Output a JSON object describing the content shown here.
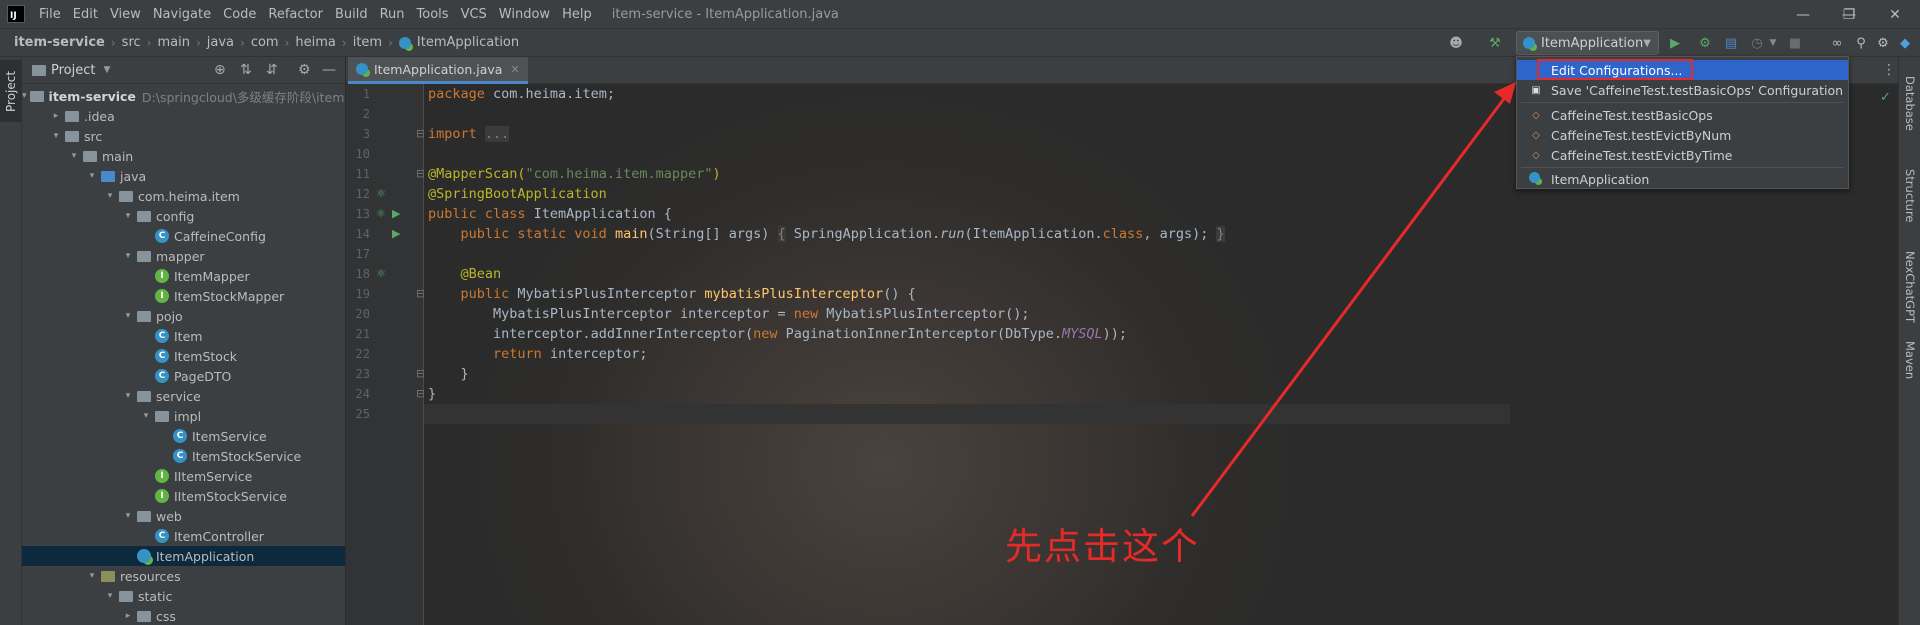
{
  "titlebar": {
    "logo": "IJ",
    "menu": [
      "File",
      "Edit",
      "View",
      "Navigate",
      "Code",
      "Refactor",
      "Build",
      "Run",
      "Tools",
      "VCS",
      "Window",
      "Help"
    ],
    "window_title": "item-service - ItemApplication.java"
  },
  "breadcrumb": [
    "item-service",
    "src",
    "main",
    "java",
    "com",
    "heima",
    "item",
    "ItemApplication"
  ],
  "run_config": {
    "selected": "ItemApplication"
  },
  "project_panel": {
    "title": "Project",
    "tree": [
      {
        "label": "item-service",
        "hint": "D:\\springcloud\\多级缓存阶段\\item-s",
        "depth": 0,
        "icon": "folder",
        "expanded": true,
        "bold": true
      },
      {
        "label": ".idea",
        "depth": 1,
        "icon": "folder",
        "expanded": false
      },
      {
        "label": "src",
        "depth": 1,
        "icon": "folder",
        "expanded": true
      },
      {
        "label": "main",
        "depth": 2,
        "icon": "folder",
        "expanded": true
      },
      {
        "label": "java",
        "depth": 3,
        "icon": "folder-blue",
        "expanded": true
      },
      {
        "label": "com.heima.item",
        "depth": 4,
        "icon": "folder",
        "expanded": true
      },
      {
        "label": "config",
        "depth": 5,
        "icon": "folder",
        "expanded": true
      },
      {
        "label": "CaffeineConfig",
        "depth": 6,
        "icon": "class"
      },
      {
        "label": "mapper",
        "depth": 5,
        "icon": "folder",
        "expanded": true
      },
      {
        "label": "ItemMapper",
        "depth": 6,
        "icon": "iface"
      },
      {
        "label": "ItemStockMapper",
        "depth": 6,
        "icon": "iface"
      },
      {
        "label": "pojo",
        "depth": 5,
        "icon": "folder",
        "expanded": true
      },
      {
        "label": "Item",
        "depth": 6,
        "icon": "class"
      },
      {
        "label": "ItemStock",
        "depth": 6,
        "icon": "class"
      },
      {
        "label": "PageDTO",
        "depth": 6,
        "icon": "class"
      },
      {
        "label": "service",
        "depth": 5,
        "icon": "folder",
        "expanded": true
      },
      {
        "label": "impl",
        "depth": 6,
        "icon": "folder",
        "expanded": true
      },
      {
        "label": "ItemService",
        "depth": 7,
        "icon": "class"
      },
      {
        "label": "ItemStockService",
        "depth": 7,
        "icon": "class"
      },
      {
        "label": "IItemService",
        "depth": 6,
        "icon": "iface"
      },
      {
        "label": "IItemStockService",
        "depth": 6,
        "icon": "iface"
      },
      {
        "label": "web",
        "depth": 5,
        "icon": "folder",
        "expanded": true
      },
      {
        "label": "ItemController",
        "depth": 6,
        "icon": "class"
      },
      {
        "label": "ItemApplication",
        "depth": 5,
        "icon": "spring",
        "selected": true
      },
      {
        "label": "resources",
        "depth": 3,
        "icon": "folder-res",
        "expanded": true
      },
      {
        "label": "static",
        "depth": 4,
        "icon": "folder",
        "expanded": true
      },
      {
        "label": "css",
        "depth": 5,
        "icon": "folder",
        "expanded": false
      }
    ]
  },
  "editor": {
    "tab": "ItemApplication.java",
    "line_numbers": [
      "1",
      "2",
      "3",
      "10",
      "11",
      "12",
      "13",
      "14",
      "17",
      "18",
      "19",
      "20",
      "21",
      "22",
      "23",
      "24",
      "25"
    ],
    "code": {
      "l1_kw": "package",
      "l1_rest": " com.heima.item;",
      "l3_kw": "import",
      "l3_fold": "...",
      "l11_ann": "@MapperScan(",
      "l11_str": "\"com.heima.item.mapper\"",
      "l11_end": ")",
      "l12_ann": "@SpringBootApplication",
      "l13_kw": "public class",
      "l13_rest": " ItemApplication {",
      "l14_kw": "public static void",
      "l14_fn": "main",
      "l14_a": "(String[] args) ",
      "l14_fold1": "{",
      "l14_b": " SpringApplication.",
      "l14_run": "run",
      "l14_c": "(ItemApplication.",
      "l14_kw2": "class",
      "l14_d": ", args); ",
      "l14_fold2": "}",
      "l18_ann": "@Bean",
      "l19_kw": "public",
      "l19_a": " MybatisPlusInterceptor ",
      "l19_fn": "mybatisPlusInterceptor",
      "l19_b": "() {",
      "l20_a": "MybatisPlusInterceptor interceptor = ",
      "l20_kw": "new",
      "l20_b": " MybatisPlusInterceptor();",
      "l21_a": "interceptor.addInnerInterceptor(",
      "l21_kw": "new",
      "l21_b": " PaginationInnerInterceptor(DbType.",
      "l21_const": "MYSQL",
      "l21_c": "));",
      "l22_kw": "return",
      "l22_a": " interceptor;",
      "l23": "}",
      "l24": "}"
    }
  },
  "popup": {
    "items": [
      {
        "label": "Edit Configurations...",
        "icon": "edit-config-icon",
        "selected": true
      },
      {
        "label": "Save 'CaffeineTest.testBasicOps' Configuration",
        "icon": "save-icon"
      },
      {
        "label": "CaffeineTest.testBasicOps",
        "icon": "test-icon"
      },
      {
        "label": "CaffeineTest.testEvictByNum",
        "icon": "test-icon"
      },
      {
        "label": "CaffeineTest.testEvictByTime",
        "icon": "test-icon"
      },
      {
        "label": "ItemApplication",
        "icon": "spring-icon"
      }
    ]
  },
  "right_tabs": [
    "Database",
    "Structure",
    "NexChatGPT",
    "Maven"
  ],
  "annotation": "先点击这个",
  "colors": {
    "accent": "#2f65ca",
    "annotation": "#e62a2a",
    "run_green": "#59a869"
  }
}
